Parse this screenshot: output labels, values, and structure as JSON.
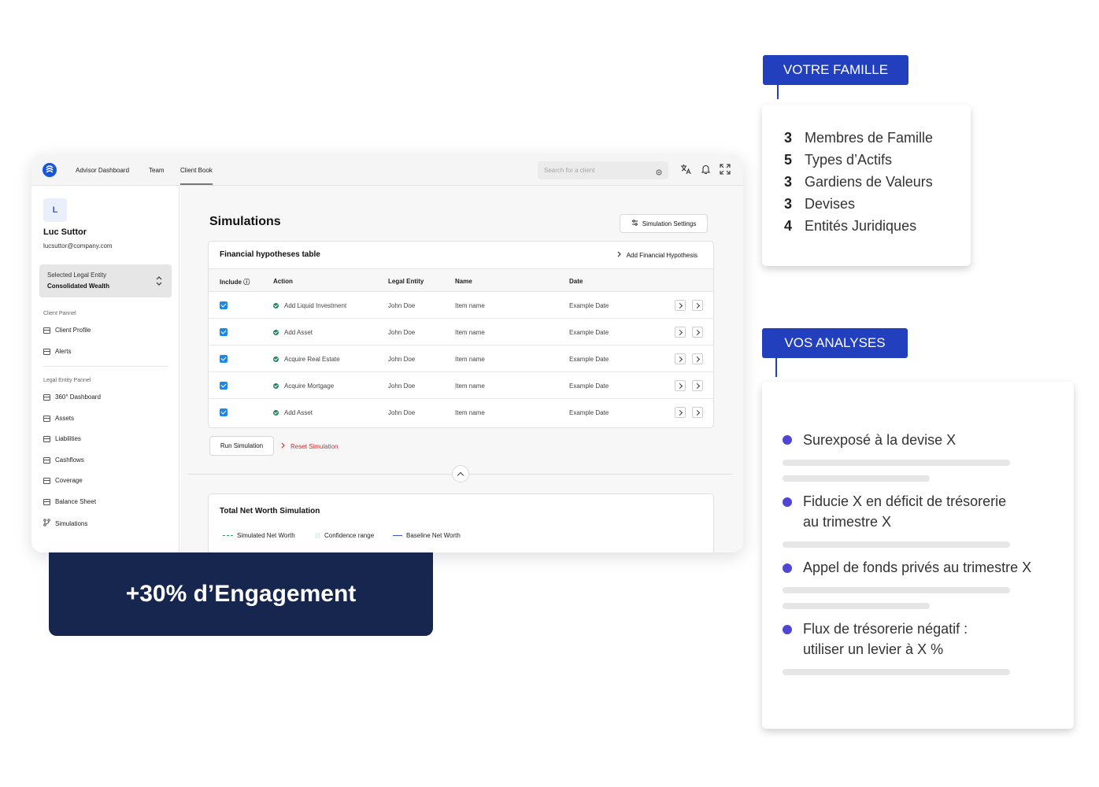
{
  "nav": {
    "items": [
      "Advisor Dashboard",
      "Team",
      "Client Book"
    ],
    "search_placeholder": "Search for a client"
  },
  "user": {
    "initial": "L",
    "name": "Luc Suttor",
    "email": "lucsuttor@company.com"
  },
  "entity_select": {
    "label": "Selected Legal Entity",
    "value": "Consolidated Wealth"
  },
  "sidebar": {
    "client_section": "Client Pannel",
    "client_items": [
      "Client Profile",
      "Alerts"
    ],
    "entity_section": "Legal Entity Pannel",
    "entity_items": [
      "360° Dashboard",
      "Assets",
      "Liabilities",
      "Cashflows",
      "Coverage",
      "Balance Sheet",
      "Simulations"
    ]
  },
  "main": {
    "title": "Simulations",
    "settings_button": "Simulation Settings",
    "table_title": "Financial hypotheses table",
    "add_hypothesis": "Add Financial Hypothesis",
    "columns": [
      "Include",
      "Action",
      "Legal Entity",
      "Name",
      "Date"
    ],
    "rows": [
      {
        "action": "Add Liquid Investment",
        "entity": "John Doe",
        "name": "Item name",
        "date": "Example Date",
        "included": true
      },
      {
        "action": "Add Asset",
        "entity": "John Doe",
        "name": "Item name",
        "date": "Example Date",
        "included": true
      },
      {
        "action": "Acquire Real Estate",
        "entity": "John Doe",
        "name": "Item name",
        "date": "Example Date",
        "included": true
      },
      {
        "action": "Acquire Mortgage",
        "entity": "John Doe",
        "name": "Item name",
        "date": "Example Date",
        "included": true
      },
      {
        "action": "Add Asset",
        "entity": "John Doe",
        "name": "Item name",
        "date": "Example Date",
        "included": true
      }
    ],
    "run_button": "Run Simulation",
    "reset_button": "Reset Simulation",
    "sim_title": "Total Net Worth Simulation",
    "legend": [
      "Simulated Net Worth",
      "Confidence range",
      "Baseline Net Worth"
    ]
  },
  "banner": "+30% d’Engagement",
  "family": {
    "tag": "VOTRE FAMILLE",
    "items": [
      {
        "count": "3",
        "label": "Membres de Famille"
      },
      {
        "count": "5",
        "label": "Types d’Actifs"
      },
      {
        "count": "3",
        "label": "Gardiens de Valeurs"
      },
      {
        "count": "3",
        "label": "Devises"
      },
      {
        "count": "4",
        "label": "Entités Juridiques"
      }
    ]
  },
  "analyses": {
    "tag": "VOS ANALYSES",
    "items": [
      {
        "line1": "Surexposé à la devise X",
        "line2": ""
      },
      {
        "line1": "Fiducie X en déficit de trésorerie",
        "line2": "au trimestre X"
      },
      {
        "line1": "Appel de fonds privés au trimestre X",
        "line2": ""
      },
      {
        "line1": "Flux de trésorerie négatif :",
        "line2": "utiliser un levier à X %"
      }
    ]
  },
  "colors": {
    "brand_blue": "#2240bd",
    "banner_navy": "#17264f",
    "bullet_purple": "#5046d6",
    "checkbox_blue": "#1e88e5",
    "reset_red": "#d32f2f"
  }
}
